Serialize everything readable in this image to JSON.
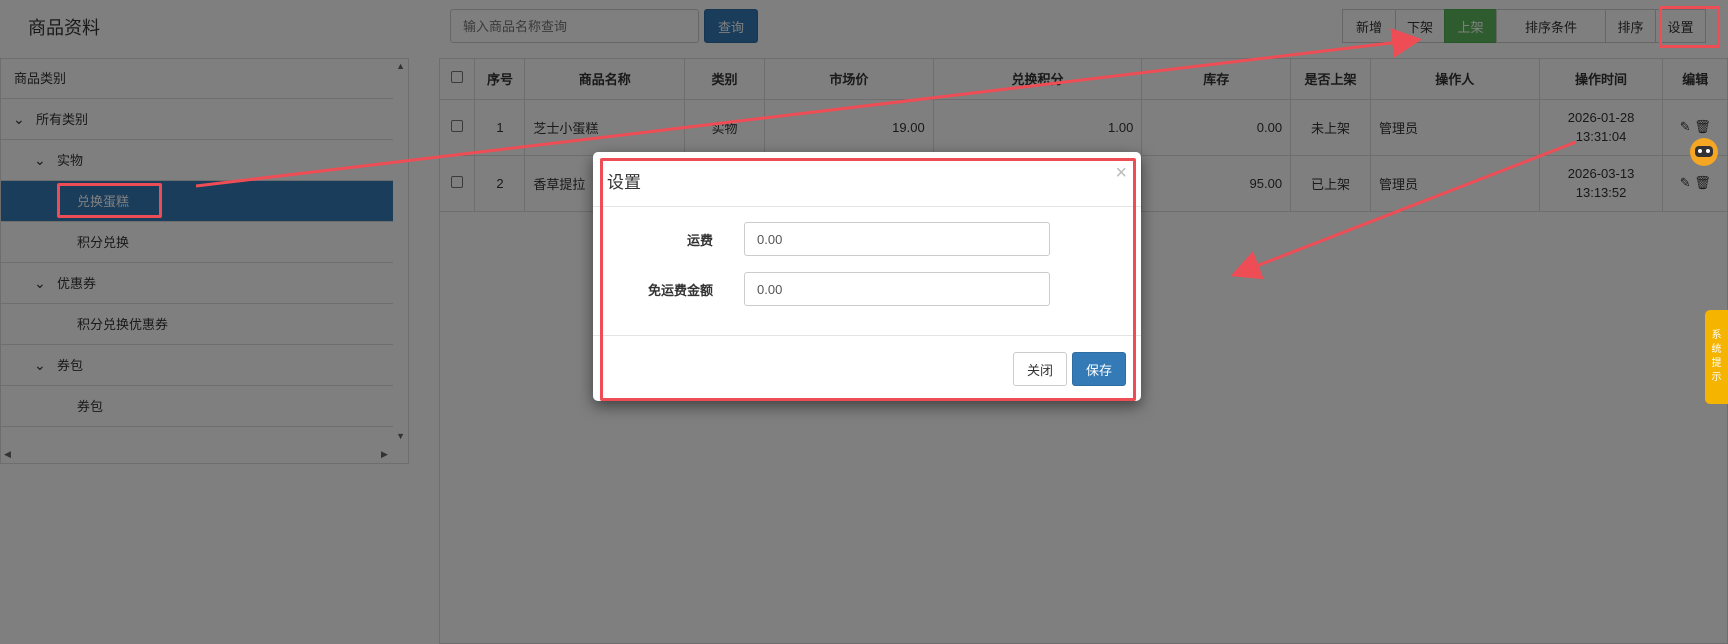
{
  "page": {
    "title": "商品资料",
    "search_placeholder": "输入商品名称查询",
    "search_button": "查询"
  },
  "toolbar": {
    "add": "新增",
    "take_down": "下架",
    "put_up": "上架",
    "sort_conditions": "排序条件",
    "sort": "排序",
    "settings": "设置"
  },
  "sidebar": {
    "header": "商品类别",
    "items": [
      {
        "label": "所有类别"
      },
      {
        "label": "实物"
      },
      {
        "label": "兑换蛋糕"
      },
      {
        "label": "积分兑换"
      },
      {
        "label": "优惠券"
      },
      {
        "label": "积分兑换优惠券"
      },
      {
        "label": "券包"
      },
      {
        "label": "券包"
      }
    ]
  },
  "table": {
    "headers": [
      "序号",
      "商品名称",
      "类别",
      "市场价",
      "兑换积分",
      "库存",
      "是否上架",
      "操作人",
      "操作时间",
      "编辑"
    ],
    "rows": [
      {
        "index": "1",
        "name": "芝士小蛋糕",
        "category": "实物",
        "market_price": "19.00",
        "points": "1.00",
        "stock": "0.00",
        "listed": "未上架",
        "operator": "管理员",
        "time_date": "2026-01-28",
        "time_clock": "13:31:04"
      },
      {
        "index": "2",
        "name": "香草提拉",
        "category": "",
        "market_price": "",
        "points": "",
        "stock": "95.00",
        "listed": "已上架",
        "operator": "管理员",
        "time_date": "2026-03-13",
        "time_clock": "13:13:52"
      }
    ]
  },
  "modal": {
    "title": "设置",
    "close_glyph": "×",
    "freight_label": "运费",
    "freight_value": "0.00",
    "free_freight_label": "免运费金额",
    "free_freight_value": "0.00",
    "close_button": "关闭",
    "save_button": "保存"
  },
  "side_tab": {
    "chars": [
      "系",
      "统",
      "提",
      "示"
    ]
  },
  "colors": {
    "primary": "#337ab7",
    "success": "#5cb85c",
    "highlight": "#ef4d55",
    "tip": "#f5b400"
  }
}
